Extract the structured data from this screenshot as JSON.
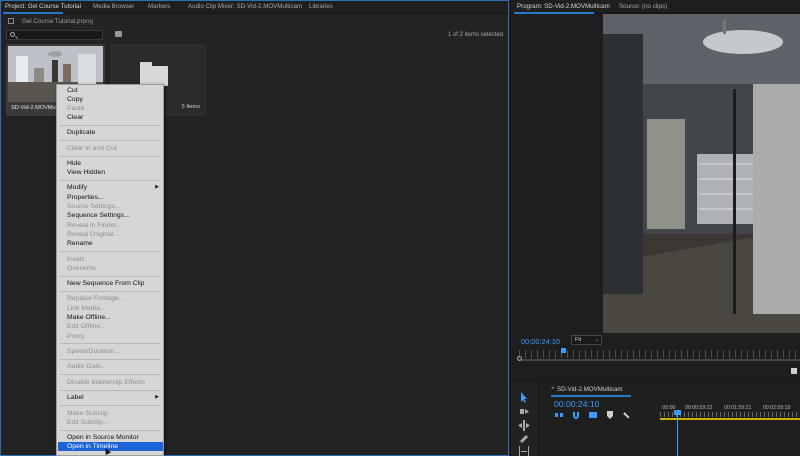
{
  "project_panel": {
    "tabs": [
      {
        "label": "Project: Gel Course Tutorial"
      },
      {
        "label": "Media Browser"
      },
      {
        "label": "Markers"
      },
      {
        "label": "Audio Clip Mixer: SD-Vid-2.MOVMulticam"
      },
      {
        "label": "Libraries"
      }
    ],
    "file_name": "Gel Course Tutorial.prproj",
    "search_placeholder": "",
    "items_selected": "1 of 2 items selected",
    "clip": {
      "name": "SD-Vid-2.MOVMultica"
    },
    "bin": {
      "count": "5 Items"
    }
  },
  "context_menu": {
    "items": [
      {
        "label": "Cut",
        "enabled": true
      },
      {
        "label": "Copy",
        "enabled": true
      },
      {
        "label": "Paste",
        "enabled": false
      },
      {
        "label": "Clear",
        "enabled": true
      },
      {
        "label": "Duplicate",
        "enabled": true
      },
      {
        "label": "Clear In and Out",
        "enabled": false
      },
      {
        "label": "Hide",
        "enabled": true
      },
      {
        "label": "View Hidden",
        "enabled": true
      },
      {
        "label": "Modify",
        "enabled": true,
        "submenu": true
      },
      {
        "label": "Properties...",
        "enabled": true
      },
      {
        "label": "Source Settings...",
        "enabled": false
      },
      {
        "label": "Sequence Settings...",
        "enabled": true
      },
      {
        "label": "Reveal in Finder...",
        "enabled": false
      },
      {
        "label": "Reveal Original...",
        "enabled": false
      },
      {
        "label": "Rename",
        "enabled": true
      },
      {
        "label": "Insert",
        "enabled": false
      },
      {
        "label": "Overwrite",
        "enabled": false
      },
      {
        "label": "New Sequence From Clip",
        "enabled": true
      },
      {
        "label": "Replace Footage...",
        "enabled": false
      },
      {
        "label": "Link Media...",
        "enabled": false
      },
      {
        "label": "Make Offline...",
        "enabled": true
      },
      {
        "label": "Edit Offline...",
        "enabled": false
      },
      {
        "label": "Proxy",
        "enabled": false,
        "submenu": true
      },
      {
        "label": "Speed/Duration...",
        "enabled": false
      },
      {
        "label": "Audio Gain...",
        "enabled": false
      },
      {
        "label": "Disable Masterclip Effects",
        "enabled": false
      },
      {
        "label": "Label",
        "enabled": true,
        "submenu": true
      },
      {
        "label": "Make Subclip",
        "enabled": false
      },
      {
        "label": "Edit Subclip...",
        "enabled": false
      },
      {
        "label": "Open in Source Monitor",
        "enabled": true
      },
      {
        "label": "Open in Timeline",
        "enabled": true,
        "selected": true
      }
    ],
    "submenu_arrow": "▶"
  },
  "program_monitor": {
    "tabs": [
      {
        "label": "Program: SD-Vid-2.MOVMulticam"
      },
      {
        "label": "Source: (no clips)"
      }
    ],
    "timecode": "00:00:24:10",
    "fit_value": "Fit",
    "fit_chevron": "⌄"
  },
  "timeline": {
    "close_glyph": "×",
    "sequence_name": "SD-Vid-2.MOVMulticam",
    "timecode": "00:00:24:10",
    "ruler_labels": [
      ":00:00",
      "00:00:59:22",
      "00:01:59:21",
      "00:02:59:19"
    ]
  },
  "colors": {
    "accent_blue": "#2a76c9",
    "timecode_blue": "#3b9bff",
    "menu_highlight": "#1c64d8",
    "workarea_yellow": "#c9b400"
  }
}
